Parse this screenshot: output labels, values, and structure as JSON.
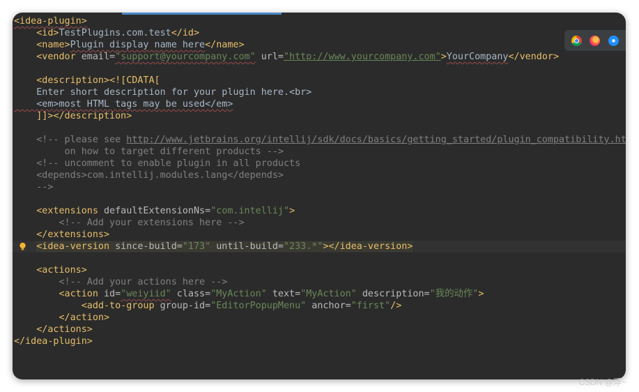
{
  "lines": [
    [
      [
        "tag",
        "<idea-plugin>",
        "sq"
      ]
    ],
    [
      [
        "txt",
        "    "
      ],
      [
        "tag",
        "<id>"
      ],
      [
        "txt",
        "TestPlugins.com.test"
      ],
      [
        "tag",
        "</id>"
      ]
    ],
    [
      [
        "txt",
        "    "
      ],
      [
        "tag",
        "<name>"
      ],
      [
        "txt",
        "Plugin display name here",
        "sq"
      ],
      [
        "tag",
        "</name>"
      ]
    ],
    [
      [
        "txt",
        "    "
      ],
      [
        "tag",
        "<vendor "
      ],
      [
        "attr",
        "email="
      ],
      [
        "val",
        "\"support@yourcompany.com\"",
        "sq"
      ],
      [
        "attr",
        " url="
      ],
      [
        "linkv",
        "\"http://www.yourcompany.com\""
      ],
      [
        "tag",
        ">"
      ],
      [
        "txt",
        "YourCompany",
        "sq"
      ],
      [
        "tag",
        "</vendor>"
      ]
    ],
    [],
    [
      [
        "txt",
        "    "
      ],
      [
        "tag",
        "<description>"
      ],
      [
        "tag",
        "<![CDATA["
      ]
    ],
    [
      [
        "txt",
        "    Enter short description for your plugin here.<br>"
      ]
    ],
    [
      [
        "txt",
        "    <em>most HTML tags may be used</em>",
        "sq"
      ]
    ],
    [
      [
        "txt",
        "    "
      ],
      [
        "tag",
        "]]>"
      ],
      [
        "tag",
        "</description>"
      ]
    ],
    [],
    [
      [
        "cmt",
        "    <!-- please see "
      ],
      [
        "link",
        "http://www.jetbrains.org/intellij/sdk/docs/basics/getting_started/plugin_compatibility.htm"
      ]
    ],
    [
      [
        "cmt",
        "         on how to target different products -->"
      ]
    ],
    [
      [
        "cmt",
        "    <!-- uncomment to enable plugin in all products"
      ]
    ],
    [
      [
        "cmt",
        "    <depends>com.intellij.modules.lang</depends>"
      ]
    ],
    [
      [
        "cmt",
        "    -->"
      ]
    ],
    [],
    [
      [
        "txt",
        "    "
      ],
      [
        "tag",
        "<extensions "
      ],
      [
        "attr",
        "defaultExtensionNs="
      ],
      [
        "val",
        "\"com.intellij\""
      ],
      [
        "tag",
        ">"
      ]
    ],
    [
      [
        "cmt",
        "        <!-- Add your extensions here -->"
      ]
    ],
    [
      [
        "txt",
        "    "
      ],
      [
        "tag",
        "</extensions>"
      ]
    ],
    [
      [
        "txt",
        "    "
      ],
      [
        "tag",
        "<idea-version "
      ],
      [
        "attr",
        "since-build="
      ],
      [
        "val",
        "\"173\""
      ],
      [
        "attr",
        " until-build="
      ],
      [
        "val",
        "\"233.*\""
      ],
      [
        "tag",
        ">"
      ],
      [
        "tag",
        "</idea-version>"
      ]
    ],
    [],
    [
      [
        "txt",
        "    "
      ],
      [
        "tag",
        "<actions>"
      ]
    ],
    [
      [
        "cmt",
        "        <!-- Add your actions here -->"
      ]
    ],
    [
      [
        "txt",
        "        "
      ],
      [
        "tag",
        "<action "
      ],
      [
        "attr",
        "id="
      ],
      [
        "val",
        "\"weiyiid\"",
        "sq"
      ],
      [
        "attr",
        " class="
      ],
      [
        "val",
        "\"MyAction\""
      ],
      [
        "attr",
        " text="
      ],
      [
        "val",
        "\"MyAction\""
      ],
      [
        "attr",
        " description="
      ],
      [
        "val",
        "\"我的动作\""
      ],
      [
        "tag",
        ">"
      ]
    ],
    [
      [
        "txt",
        "            "
      ],
      [
        "tag",
        "<add-to-group "
      ],
      [
        "attr",
        "group-id="
      ],
      [
        "val",
        "\"EditorPopupMenu\""
      ],
      [
        "attr",
        " anchor="
      ],
      [
        "val",
        "\"first\""
      ],
      [
        "tag",
        "/>"
      ]
    ],
    [
      [
        "txt",
        "        "
      ],
      [
        "tag",
        "</action>"
      ]
    ],
    [
      [
        "txt",
        "    "
      ],
      [
        "tag",
        "</actions>"
      ]
    ],
    [
      [
        "tag",
        "</idea-plugin>"
      ]
    ]
  ],
  "bulb_line": 19,
  "highlight_line": 19,
  "browser_icons": [
    "chrome-icon",
    "firefox-icon",
    "safari-icon"
  ],
  "watermark": "CSDN @浮~"
}
